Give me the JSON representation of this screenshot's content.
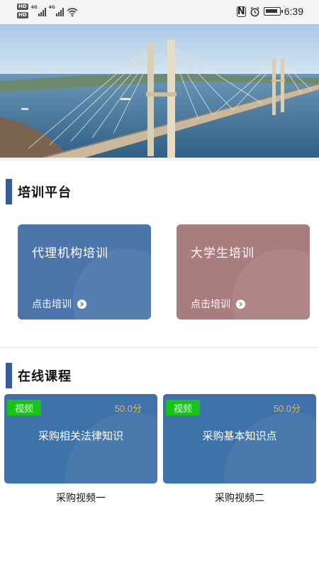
{
  "status_bar": {
    "hd1": "HD",
    "hd2": "HD",
    "net1": "4G",
    "net2": "4G",
    "nfc": "N",
    "time": "6:39",
    "icons": [
      "signal-icon",
      "wifi-icon",
      "nfc-icon",
      "alarm-icon",
      "battery-icon"
    ]
  },
  "banner": {
    "icon": "bridge-photo",
    "colors": {
      "sky": "#bcd6ea",
      "water": "#4a7fa6",
      "deck": "#c9b89c"
    }
  },
  "training": {
    "title": "培训平台",
    "cards": [
      {
        "title": "代理机构培训",
        "action": "点击培训",
        "color": "#4c75ab"
      },
      {
        "title": "大学生培训",
        "action": "点击培训",
        "color": "#a97c7e"
      }
    ]
  },
  "courses": {
    "title": "在线课程",
    "items": [
      {
        "badge": "视频",
        "score": "50.0分",
        "title": "采购相关法律知识",
        "caption": "采购视频一"
      },
      {
        "badge": "视频",
        "score": "50.0分",
        "title": "采购基本知识点",
        "caption": "采购视频二"
      }
    ]
  }
}
